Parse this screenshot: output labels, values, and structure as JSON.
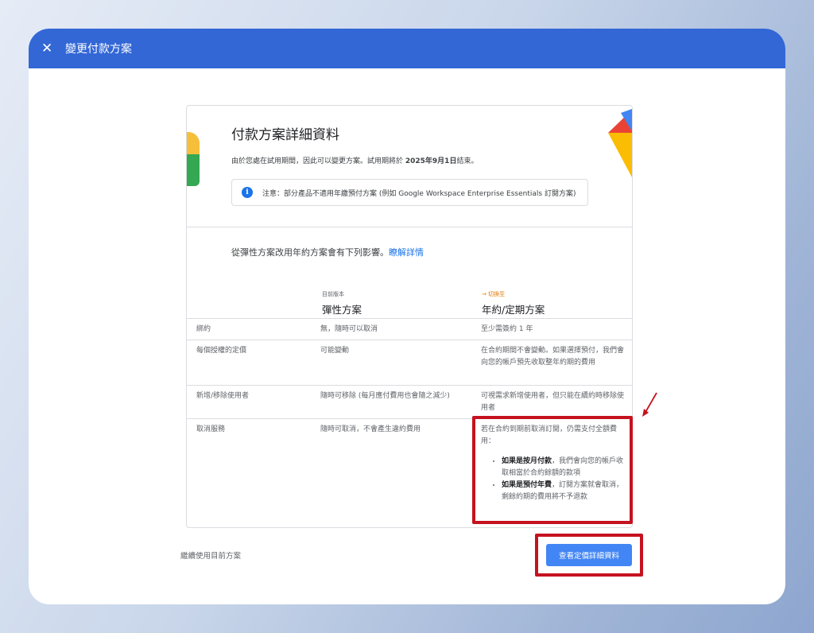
{
  "header": {
    "title": "變更付款方案"
  },
  "details": {
    "title": "付款方案詳細資料",
    "trial_prefix": "由於您處在試用期間，因此可以變更方案。試用期將於 ",
    "trial_date": "2025年9月1日",
    "trial_suffix": "結束。",
    "notice": "注意：部分產品不適用年繳預付方案 (例如 Google Workspace Enterprise Essentials 訂閱方案)"
  },
  "impact": {
    "text": "從彈性方案改用年約方案會有下列影響。",
    "link": "瞭解詳情"
  },
  "comparison": {
    "current_label": "目前版本",
    "current_plan": "彈性方案",
    "switch_label": "→ 切換至",
    "target_plan": "年約/定期方案",
    "rows": [
      {
        "feature": "綁約",
        "current": "無，隨時可以取消",
        "target": "至少需簽約 1 年"
      },
      {
        "feature": "每個授權的定價",
        "current": "可能變動",
        "target": "在合約期間不會變動。如果選擇預付，我們會向您的帳戶預先收取整年約期的費用"
      },
      {
        "feature": "新增/移除使用者",
        "current": "隨時可移除 (每月應付費用也會隨之減少)",
        "target": "可視需求新增使用者，但只能在續約時移除使用者"
      },
      {
        "feature": "取消服務",
        "current": "隨時可取消，不會產生違約費用",
        "target_intro": "若在合約到期前取消訂閱，仍需支付全額費用：",
        "bullets": [
          {
            "bold": "如果是按月付款",
            "text": "，我們會向您的帳戶收取相當於合約餘額的款項"
          },
          {
            "bold": "如果是預付年費",
            "text": "，訂閱方案就會取消，剩餘約期的費用將不予退款"
          }
        ]
      }
    ]
  },
  "footer": {
    "keep_current": "繼續使用目前方案",
    "view_pricing": "查看定價詳細資料"
  },
  "colors": {
    "header_bg": "#3367d6",
    "primary_button": "#4285f4",
    "highlight": "#c5121f",
    "switch_label": "#e37400"
  }
}
